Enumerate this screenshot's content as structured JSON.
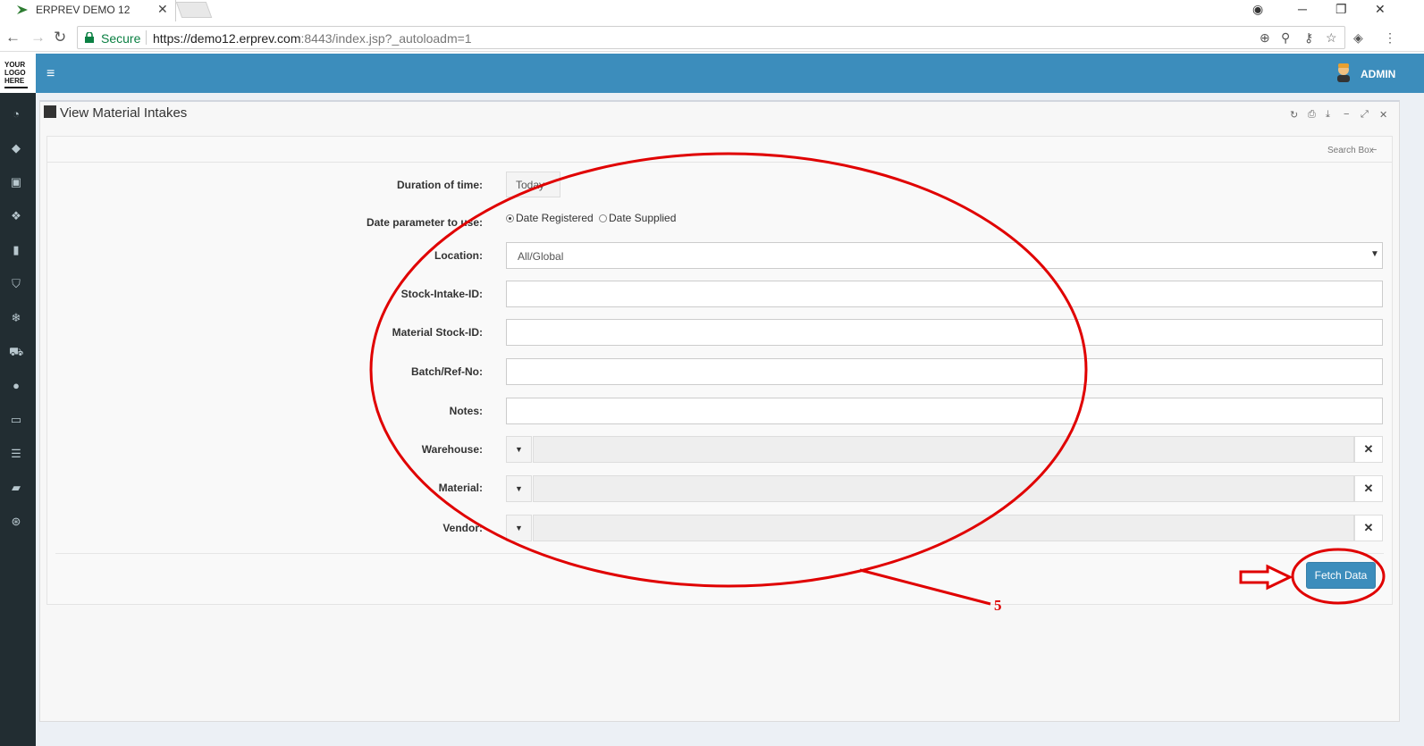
{
  "browser": {
    "tab_title": "ERPREV DEMO 12",
    "tab_close": "✕",
    "secure_label": "Secure",
    "url_main": "https://demo12.erprev.com",
    "url_rest": ":8443/index.jsp?_autoloadm=1"
  },
  "header": {
    "logo_lines": [
      "YOUR",
      "LOGO",
      "HERE"
    ],
    "user": "ADMIN"
  },
  "panel": {
    "title": "View Material Intakes",
    "search_box_label": "Search Box"
  },
  "form": {
    "duration_label": "Duration of time:",
    "duration_value": "Today",
    "date_param_label": "Date parameter to use:",
    "radio_registered": "Date Registered",
    "radio_supplied": "Date Supplied",
    "location_label": "Location:",
    "location_value": "All/Global",
    "stock_intake_label": "Stock-Intake-ID:",
    "material_stock_label": "Material Stock-ID:",
    "batch_label": "Batch/Ref-No:",
    "notes_label": "Notes:",
    "warehouse_label": "Warehouse:",
    "material_label": "Material:",
    "vendor_label": "Vendor:"
  },
  "actions": {
    "fetch_label": "Fetch Data"
  },
  "annotation": {
    "number": "5",
    "color": "#e00000"
  },
  "colors": {
    "header": "#3c8dbc",
    "sidebar": "#222d32"
  }
}
